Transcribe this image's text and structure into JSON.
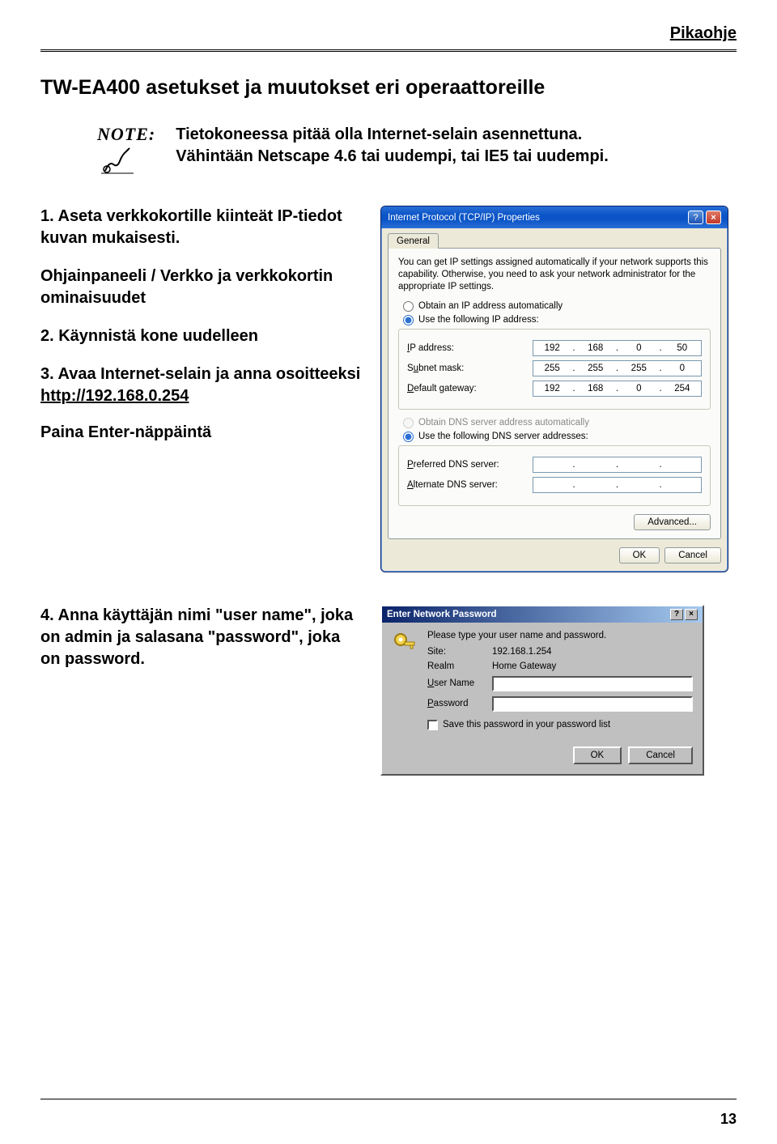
{
  "doc": {
    "header": "Pikaohje",
    "title": "TW-EA400 asetukset ja muutokset eri operaattoreille",
    "page_number": "13"
  },
  "note": {
    "caption": "NOTE:",
    "text_line1": "Tietokoneessa pitää olla Internet-selain asennettuna.",
    "text_line2": "Vähintään Netscape 4.6 tai uudempi, tai IE5 tai uudempi."
  },
  "steps": {
    "s1_a": "1. Aseta verkkokortille kiinteät IP-tiedot kuvan mukaisesti.",
    "s1_b": "Ohjainpaneeli / Verkko ja verkkokortin ominaisuudet",
    "s2": "2. Käynnistä kone uudelleen",
    "s3_a": "3. Avaa Internet-selain ja anna osoitteeksi ",
    "s3_link": "http://192.168.0.254",
    "s3_b": "Paina Enter-näppäintä",
    "s4_a": "4. Anna käyttäjän nimi \"user name\", joka on ",
    "s4_admin": "admin",
    "s4_b": " ja salasana \"password\", joka on ",
    "s4_pw": "password",
    "s4_c": "."
  },
  "tcpip": {
    "title": "Internet Protocol (TCP/IP) Properties",
    "tab": "General",
    "intro": "You can get IP settings assigned automatically if your network supports this capability. Otherwise, you need to ask your network administrator for the appropriate IP settings.",
    "r_auto_ip": "Obtain an IP address automatically",
    "r_use_ip": "Use the following IP address:",
    "l_ip": "IP address:",
    "l_sn": "Subnet mask:",
    "l_gw": "Default gateway:",
    "ip": {
      "a": "192",
      "b": "168",
      "c": "0",
      "d": "50"
    },
    "sn": {
      "a": "255",
      "b": "255",
      "c": "255",
      "d": "0"
    },
    "gw": {
      "a": "192",
      "b": "168",
      "c": "0",
      "d": "254"
    },
    "r_auto_dns": "Obtain DNS server address automatically",
    "r_use_dns": "Use the following DNS server addresses:",
    "l_pref": "Preferred DNS server:",
    "l_alt": "Alternate DNS server:",
    "btn_adv": "Advanced...",
    "btn_ok": "OK",
    "btn_cancel": "Cancel"
  },
  "pw": {
    "title": "Enter Network Password",
    "prompt": "Please type your user name and password.",
    "l_site": "Site:",
    "v_site": "192.168.1.254",
    "l_realm": "Realm",
    "v_realm": "Home Gateway",
    "l_user": "User Name",
    "l_pass": "Password",
    "chk": "Save this password in your password list",
    "btn_ok": "OK",
    "btn_cancel": "Cancel"
  }
}
